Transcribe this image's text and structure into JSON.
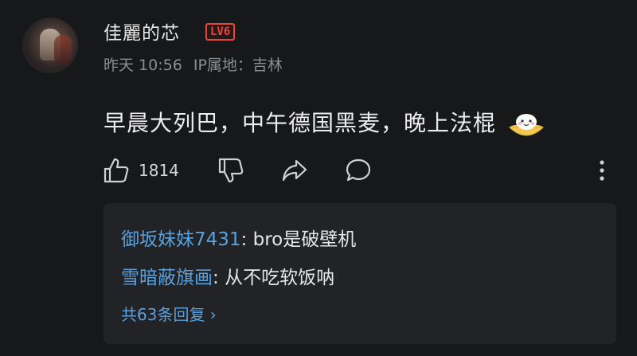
{
  "comment": {
    "username": "佳麗的芯",
    "level_badge": "LV6",
    "time": "昨天 10:56",
    "ip_location": "IP属地：吉林",
    "text": "早晨大列巴，中午德国黑麦，晚上法棍",
    "emoji": "bread-bowl-emoji"
  },
  "actions": {
    "like_count": "1814",
    "like_icon": "thumbs-up-icon",
    "dislike_icon": "thumbs-down-icon",
    "share_icon": "share-icon",
    "reply_icon": "comment-icon",
    "more_icon": "more-vertical-icon"
  },
  "replies": {
    "items": [
      {
        "user": "御坂妹妹7431",
        "separator": ": ",
        "text": "bro是破壁机"
      },
      {
        "user": "雪暗蔽旗画",
        "separator": ": ",
        "text": "从不吃软饭呐"
      }
    ],
    "more_label": "共63条回复 ›"
  },
  "colors": {
    "background": "#17181a",
    "reply_panel": "#222326",
    "link_blue": "#5aa0dc",
    "badge_red": "#e5473f",
    "meta_gray": "#8b8d92"
  }
}
